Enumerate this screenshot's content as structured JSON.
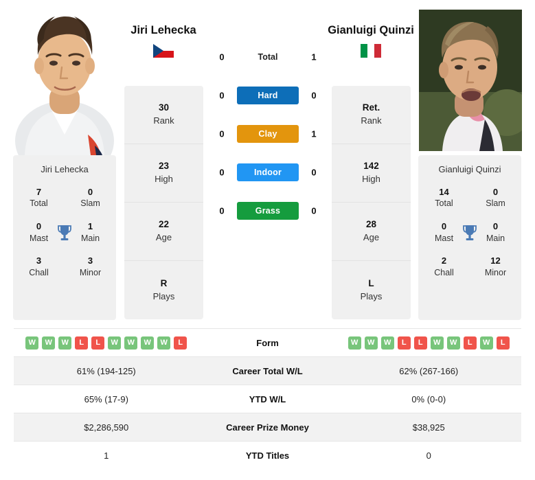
{
  "players": {
    "left": {
      "name": "Jiri Lehecka",
      "country_flag": "czech-republic-flag",
      "card_name": "Jiri Lehecka",
      "titles": {
        "total_value": "7",
        "total_label": "Total",
        "slam_value": "0",
        "slam_label": "Slam",
        "mast_value": "0",
        "mast_label": "Mast",
        "main_value": "1",
        "main_label": "Main",
        "chall_value": "3",
        "chall_label": "Chall",
        "minor_value": "3",
        "minor_label": "Minor"
      },
      "stats": [
        {
          "value": "30",
          "label": "Rank"
        },
        {
          "value": "23",
          "label": "High"
        },
        {
          "value": "22",
          "label": "Age"
        },
        {
          "value": "R",
          "label": "Plays"
        }
      ],
      "form": [
        "W",
        "W",
        "W",
        "L",
        "L",
        "W",
        "W",
        "W",
        "W",
        "L"
      ],
      "career_total_wl": "61% (194-125)",
      "ytd_wl": "65% (17-9)",
      "career_prize_money": "$2,286,590",
      "ytd_titles": "1"
    },
    "right": {
      "name": "Gianluigi Quinzi",
      "country_flag": "italy-flag",
      "card_name": "Gianluigi Quinzi",
      "titles": {
        "total_value": "14",
        "total_label": "Total",
        "slam_value": "0",
        "slam_label": "Slam",
        "mast_value": "0",
        "mast_label": "Mast",
        "main_value": "0",
        "main_label": "Main",
        "chall_value": "2",
        "chall_label": "Chall",
        "minor_value": "12",
        "minor_label": "Minor"
      },
      "stats": [
        {
          "value": "Ret.",
          "label": "Rank"
        },
        {
          "value": "142",
          "label": "High"
        },
        {
          "value": "28",
          "label": "Age"
        },
        {
          "value": "L",
          "label": "Plays"
        }
      ],
      "form": [
        "W",
        "W",
        "W",
        "L",
        "L",
        "W",
        "W",
        "L",
        "W",
        "L"
      ],
      "career_total_wl": "62% (267-166)",
      "ytd_wl": "0% (0-0)",
      "career_prize_money": "$38,925",
      "ytd_titles": "0"
    }
  },
  "h2h": {
    "rows": [
      {
        "label": "Total",
        "left": "0",
        "right": "1",
        "color": ""
      },
      {
        "label": "Hard",
        "left": "0",
        "right": "0",
        "color": "#0d6eb8"
      },
      {
        "label": "Clay",
        "left": "0",
        "right": "1",
        "color": "#e3950d"
      },
      {
        "label": "Indoor",
        "left": "0",
        "right": "0",
        "color": "#2196f3"
      },
      {
        "label": "Grass",
        "left": "0",
        "right": "0",
        "color": "#159c3e"
      }
    ]
  },
  "table": {
    "form_label": "Form",
    "career_total_wl_label": "Career Total W/L",
    "ytd_wl_label": "YTD W/L",
    "career_prize_money_label": "Career Prize Money",
    "ytd_titles_label": "YTD Titles"
  },
  "colors": {
    "win": "#78c57b",
    "loss": "#f0544b",
    "hard": "#0d6eb8",
    "clay": "#e3950d",
    "indoor": "#2196f3",
    "grass": "#159c3e",
    "trophy": "#4a7ab5",
    "card_bg": "#f0f0f0",
    "row_shade": "#f2f2f2"
  }
}
